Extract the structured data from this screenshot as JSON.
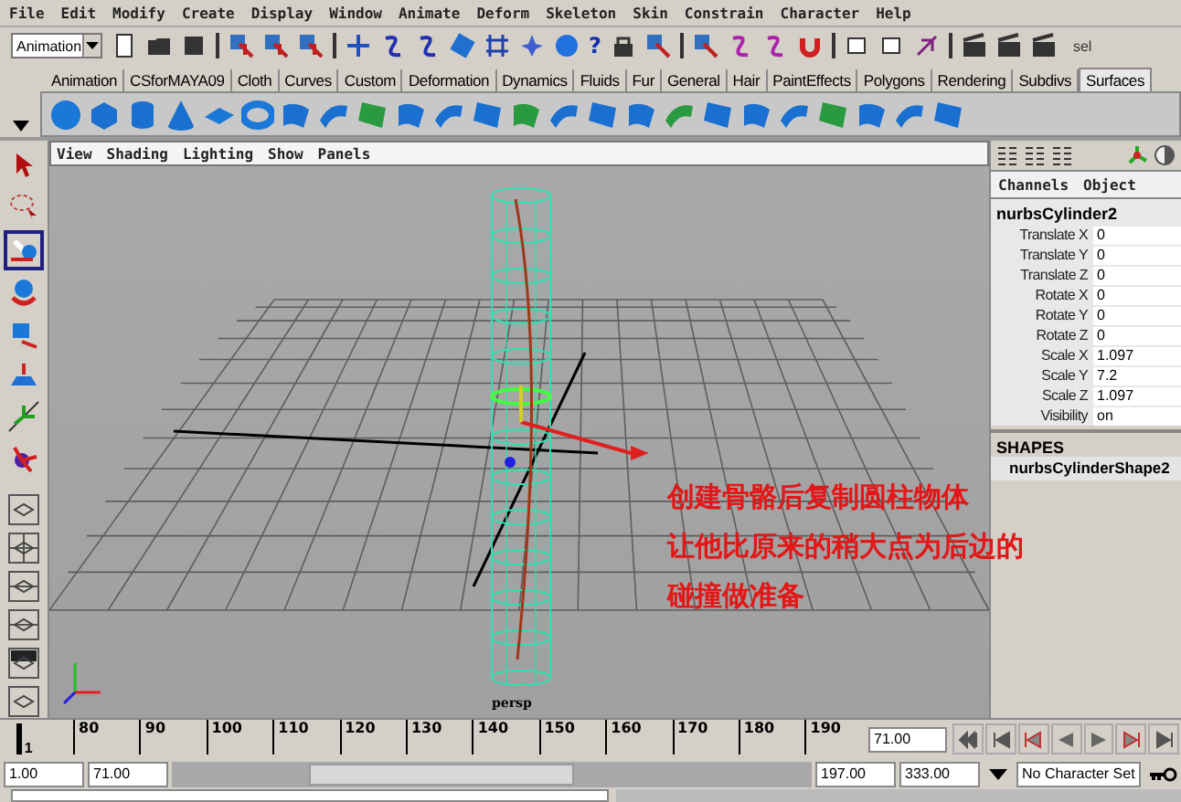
{
  "menu_bar": [
    "File",
    "Edit",
    "Modify",
    "Create",
    "Display",
    "Window",
    "Animate",
    "Deform",
    "Skeleton",
    "Skin",
    "Constrain",
    "Character",
    "Help"
  ],
  "status_line": {
    "mode": "Animation",
    "help": "?",
    "sel": "sel"
  },
  "shelf_tabs": [
    {
      "label": "Animation",
      "selected": false
    },
    {
      "label": "CSforMAYA09",
      "selected": false
    },
    {
      "label": "Cloth",
      "selected": false
    },
    {
      "label": "Curves",
      "selected": false
    },
    {
      "label": "Custom",
      "selected": false
    },
    {
      "label": "Deformation",
      "selected": false
    },
    {
      "label": "Dynamics",
      "selected": false
    },
    {
      "label": "Fluids",
      "selected": false
    },
    {
      "label": "Fur",
      "selected": false
    },
    {
      "label": "General",
      "selected": false
    },
    {
      "label": "Hair",
      "selected": false
    },
    {
      "label": "PaintEffects",
      "selected": false
    },
    {
      "label": "Polygons",
      "selected": false
    },
    {
      "label": "Rendering",
      "selected": false
    },
    {
      "label": "Subdivs",
      "selected": false
    },
    {
      "label": "Surfaces",
      "selected": true
    }
  ],
  "toolbox": [
    {
      "kind": "arrow",
      "selected": false
    },
    {
      "kind": "lasso",
      "selected": false
    },
    {
      "kind": "move",
      "selected": true
    },
    {
      "kind": "rotate",
      "selected": false
    },
    {
      "kind": "scale",
      "selected": false
    },
    {
      "kind": "soft",
      "selected": false
    },
    {
      "kind": "manip",
      "selected": false
    },
    {
      "kind": "joint",
      "selected": false
    }
  ],
  "viewport": {
    "menu": [
      "View",
      "Shading",
      "Lighting",
      "Show",
      "Panels"
    ],
    "camera": "persp",
    "caption": [
      "创建骨骼后复制圆柱物体",
      "让他比原来的稍大点为后边的",
      "碰撞做准备"
    ]
  },
  "channel_box": {
    "menu": [
      "Channels",
      "Object"
    ],
    "node": "nurbsCylinder2",
    "attributes": [
      {
        "name": "Translate X",
        "value": "0"
      },
      {
        "name": "Translate Y",
        "value": "0"
      },
      {
        "name": "Translate Z",
        "value": "0"
      },
      {
        "name": "Rotate X",
        "value": "0"
      },
      {
        "name": "Rotate Y",
        "value": "0"
      },
      {
        "name": "Rotate Z",
        "value": "0"
      },
      {
        "name": "Scale X",
        "value": "1.097"
      },
      {
        "name": "Scale Y",
        "value": "7.2"
      },
      {
        "name": "Scale Z",
        "value": "1.097"
      },
      {
        "name": "Visibility",
        "value": "on"
      }
    ],
    "shapes_header": "SHAPES",
    "shape": "nurbsCylinderShape2"
  },
  "time_slider": {
    "playhead_label": "1",
    "level": 0.02,
    "ticks": [
      "80",
      "90",
      "100",
      "110",
      "120",
      "130",
      "140",
      "150",
      "160",
      "170",
      "180",
      "190"
    ],
    "current_time": "71.00"
  },
  "range_slider": {
    "start": "1.00",
    "range_start": "71.00",
    "range_end": "197.00",
    "end": "333.00",
    "character_set": "No Character Set"
  }
}
